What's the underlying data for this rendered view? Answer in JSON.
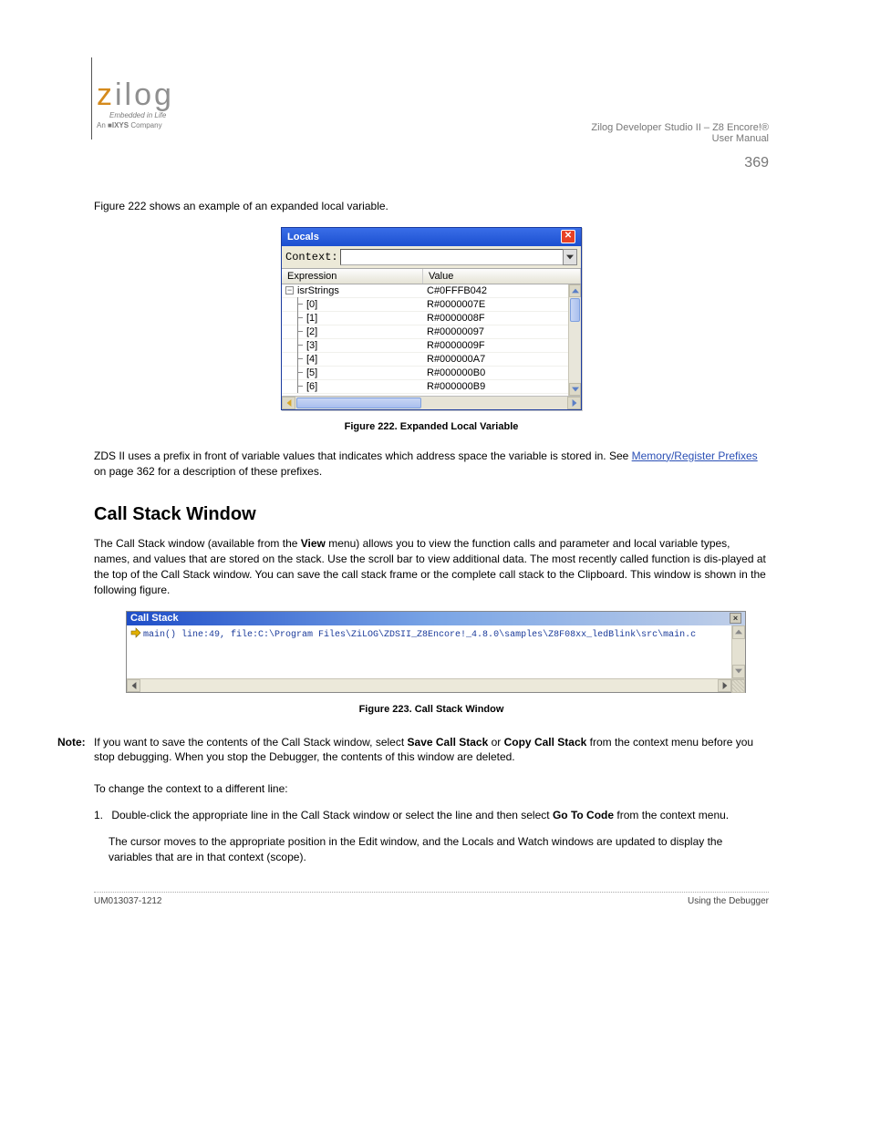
{
  "logo": {
    "brand_z": "z",
    "brand_rest": "ilog",
    "tagline": "Embedded in Life",
    "company_prefix": "An",
    "company_ixys": "IXYS",
    "company_suffix": "Company"
  },
  "header": {
    "doc_title": "Zilog Developer Studio II – Z8 Encore!®",
    "user_manual": "User Manual",
    "page_no": "369"
  },
  "locals_intro": "Figure 222 shows an example of an expanded local variable.",
  "locals_window": {
    "title": "Locals",
    "context_label": "Context:",
    "context_value": "",
    "columns": {
      "expr": "Expression",
      "value": "Value"
    },
    "root": {
      "name": "isrStrings",
      "value": "C#0FFFB042"
    },
    "children": [
      {
        "name": "[0]",
        "value": "R#0000007E"
      },
      {
        "name": "[1]",
        "value": "R#0000008F"
      },
      {
        "name": "[2]",
        "value": "R#00000097"
      },
      {
        "name": "[3]",
        "value": "R#0000009F"
      },
      {
        "name": "[4]",
        "value": "R#000000A7"
      },
      {
        "name": "[5]",
        "value": "R#000000B0"
      },
      {
        "name": "[6]",
        "value": "R#000000B9"
      }
    ]
  },
  "fig222": "Figure 222. Expanded Local Variable",
  "prefix_note_1": "ZDS II uses a prefix in front of variable values that indicates which address space the variable is stored in. See ",
  "prefix_note_link": "Memory/Register Prefixes",
  "prefix_note_2": " on page 362 for a description of these prefixes.",
  "callstack_section": {
    "heading": "Call Stack Window",
    "p1a": "The Call Stack window (available from the ",
    "p1b": "View",
    "p1c": " menu) allows you to view the function",
    "p2a": "calls and parameter and local variable types, names, and values that are stored on the stack. Use the scroll bar to view additional data. The most recently called function is dis-played at the top of the Call Stack window. You can save the call stack frame or the complete call stack to the Clipboard. This window is shown in the following figure."
  },
  "callstack_window": {
    "title": "Call Stack",
    "line": "main() line:49, file:C:\\Program Files\\ZiLOG\\ZDSII_Z8Encore!_4.8.0\\samples\\Z8F08xx_ledBlink\\src\\main.c"
  },
  "fig223": "Figure 223. Call Stack Window",
  "note": {
    "label": "Note:",
    "p1a": "If you want to save the contents of the Call Stack window, select ",
    "p1b": "Save Call Stack",
    "p1c": " or ",
    "p1d": "Copy Call Stack",
    "p1e": " from the context menu before you stop debugging. When you stop the Debugger, the contents of this window are deleted."
  },
  "procedure": {
    "intro": "To change the context to a different line:",
    "step_no": "1.",
    "step_a": "Double-click the appropriate line in the Call Stack window or select the line and then select ",
    "step_b": "Go To Code",
    "step_c": " from the context menu.",
    "after": "The cursor moves to the appropriate position in the Edit window, and the Locals and Watch windows are updated to display the variables that are in that context (scope)."
  },
  "footer": {
    "doc_no": "UM013037-1212",
    "section": "Using the Debugger"
  }
}
